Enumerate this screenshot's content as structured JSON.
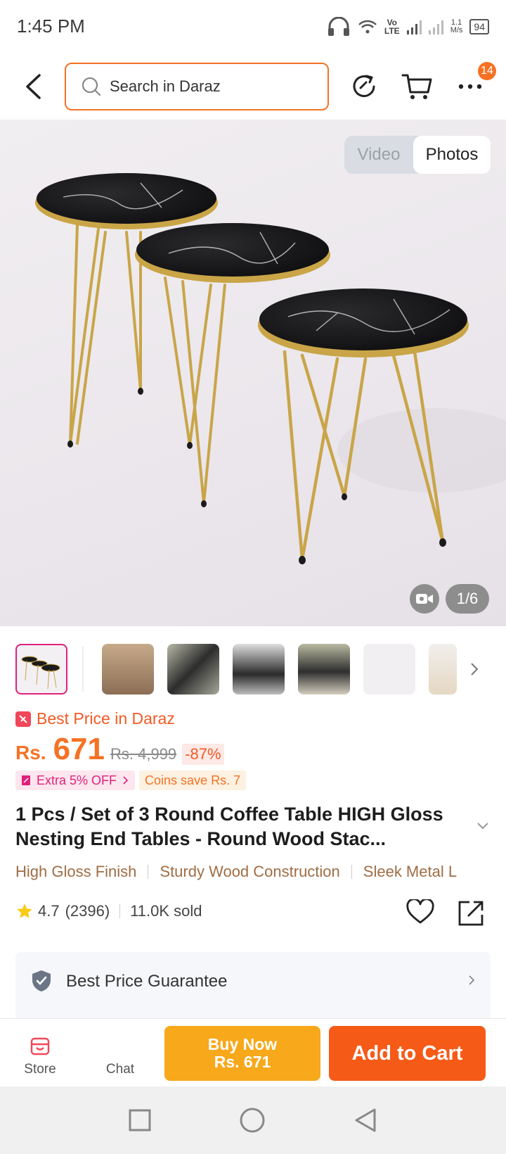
{
  "status_bar": {
    "time": "1:45 PM",
    "network_top": "Vo",
    "network_bottom": "LTE",
    "speed_value": "1.1",
    "speed_unit": "M/s",
    "battery": "94"
  },
  "header": {
    "search_placeholder": "Search in Daraz",
    "cart_badge_count": "14",
    "accent_color": "#f57224"
  },
  "gallery": {
    "toggle_video": "Video",
    "toggle_photos": "Photos",
    "counter": "1/6",
    "thumbnail_count": 7
  },
  "product": {
    "best_price_label": "Best Price in Daraz",
    "currency": "Rs.",
    "price": "671",
    "original_price": "Rs. 4,999",
    "discount": "-87%",
    "promo_extra": "Extra 5% OFF",
    "promo_coins": "Coins save Rs. 7",
    "title": "1 Pcs / Set of 3 Round Coffee Table HIGH Gloss Nesting End Tables - Round Wood Stac...",
    "features": [
      "High Gloss Finish",
      "Sturdy Wood Construction",
      "Sleek Metal L"
    ],
    "rating": "4.7",
    "rating_count": "(2396)",
    "sold": "11.0K sold",
    "guarantee": "Best Price Guarantee"
  },
  "action_bar": {
    "store_label": "Store",
    "chat_label": "Chat",
    "buy_now_label": "Buy Now",
    "buy_now_price": "Rs. 671",
    "add_to_cart_label": "Add to Cart"
  },
  "icons": [
    "back-icon",
    "search-icon",
    "share-icon",
    "cart-icon",
    "more-icon",
    "video-camera-icon",
    "chevron-right-icon",
    "chevron-down-icon",
    "star-icon",
    "heart-icon",
    "share-out-icon",
    "shield-check-icon",
    "store-icon",
    "square-icon",
    "circle-icon",
    "triangle-back-icon"
  ]
}
